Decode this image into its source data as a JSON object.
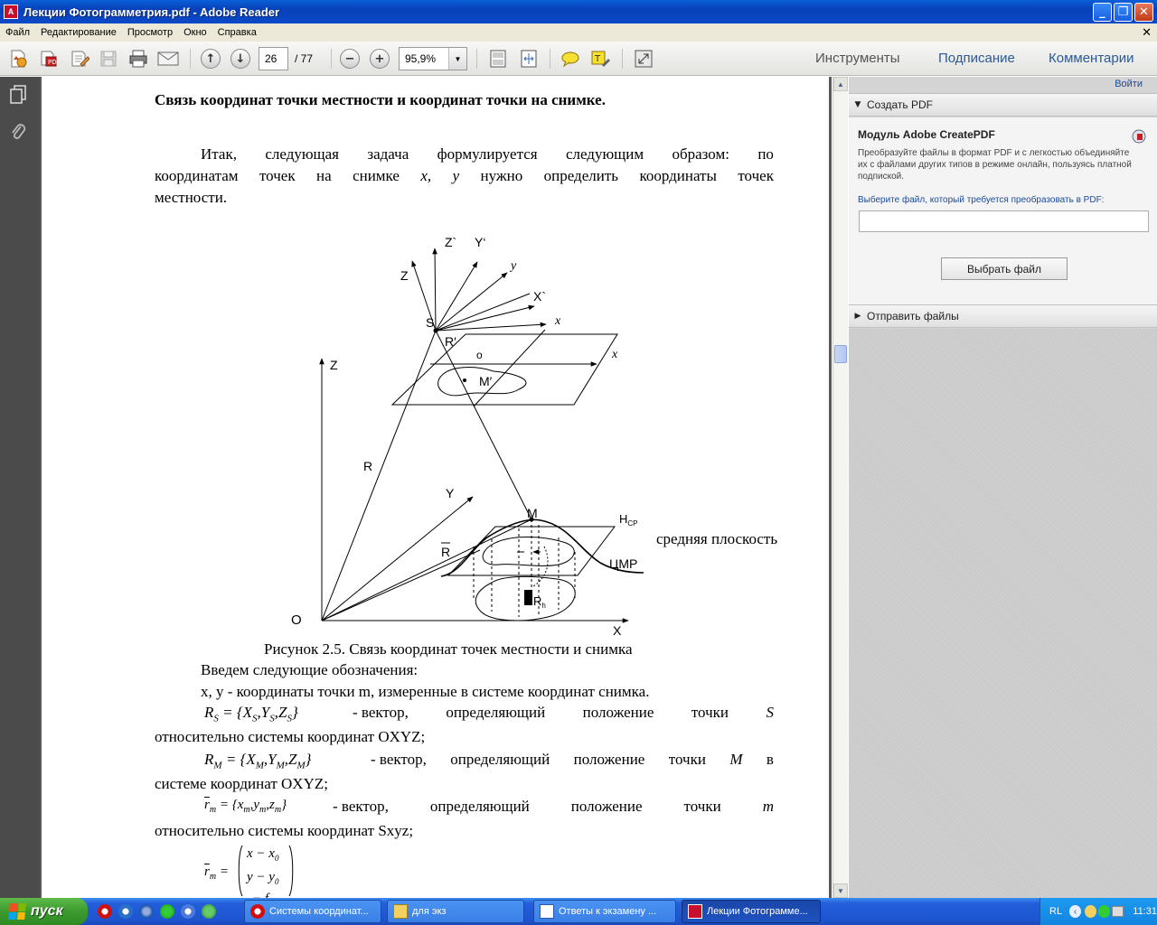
{
  "window": {
    "title": "Лекции Фотограмметрия.pdf - Adobe Reader",
    "minimize": "_",
    "maximize": "❐",
    "close": "✕"
  },
  "menu": {
    "items": [
      "Файл",
      "Редактирование",
      "Просмотр",
      "Окно",
      "Справка"
    ],
    "close": "✕"
  },
  "toolbar": {
    "page_current": "26",
    "page_total": "/ 77",
    "zoom_value": "95,9%",
    "zoom_out": "−",
    "zoom_in": "+",
    "tab_tools": "Инструменты",
    "tab_sign": "Подписание",
    "tab_comment": "Комментарии"
  },
  "document": {
    "heading": "Связь координат точки местности и координат точки на снимке.",
    "para1_line1": [
      "Итак,",
      "следующая",
      "задача",
      "формулируется",
      "следующим",
      "образом:",
      "по"
    ],
    "para1_line2": [
      "координатам",
      "точек",
      "на",
      "снимке",
      "x,",
      "y",
      "нужно",
      "определить",
      "координаты",
      "точек"
    ],
    "para1_line3": "местности.",
    "figure": {
      "label_z_prime": "Z`",
      "label_y_prime": "Y‘",
      "label_y_small": "y",
      "label_z_small": "Z",
      "label_x_prime": "X`",
      "label_s": "S",
      "label_x_small1": "x",
      "label_r_prime": "R′",
      "label_o_small": "o",
      "label_x_small2": "x",
      "label_m_prime": "M′",
      "label_z_axis": "Z",
      "label_r": "R",
      "label_y_axis": "Y",
      "label_m": "M",
      "label_hcp": "H",
      "label_hcp_sub": "CP",
      "label_mean_plane": "средняя плоскость",
      "label_r_bar": "R",
      "label_cmr": "ЦМР",
      "label_rh": "R",
      "label_rh_sub": "h",
      "label_origin": "O",
      "label_x_axis": "X"
    },
    "caption": "Рисунок 2.5. Связь координат точек местности и снимка",
    "intro": "Введем следующие обозначения:",
    "def_xy": "x, y - координаты точки m, измеренные в системе координат снимка.",
    "def_rs_formula": "R",
    "def_rs_text": [
      "- вектор,",
      "определяющий",
      "положение",
      "точки",
      "S"
    ],
    "def_rs_line2": "относительно системы координат OXYZ;",
    "def_rm_text": [
      "- вектор,",
      "определяющий",
      "положение",
      "точки",
      "M",
      "в"
    ],
    "def_rm_line2": "системе координат OXYZ;",
    "def_r_small_text": [
      "- вектор,",
      "определяющий",
      "положение",
      "точки",
      "m"
    ],
    "def_r_small_line2": "относительно системы координат Sxyz;",
    "matrix_rows": [
      "x − x",
      "y − y",
      "− f"
    ]
  },
  "right_panel": {
    "sign_in": "Войти",
    "section_create": "Создать PDF",
    "module_title": "Модуль Adobe CreatePDF",
    "module_desc": "Преобразуйте файлы в формат PDF и с легкостью объединяйте их с файлами других типов в режиме онлайн, пользуясь платной подпиской.",
    "choose_label": "Выберите файл, который требуется преобразовать в PDF:",
    "pick_button": "Выбрать файл",
    "section_send": "Отправить файлы"
  },
  "taskbar": {
    "start": "пуск",
    "tasks": [
      "Системы координат...",
      "для экз",
      "Ответы к экзамену ...",
      "Лекции Фотограмме..."
    ],
    "lang": "RL",
    "clock": "11:31"
  }
}
